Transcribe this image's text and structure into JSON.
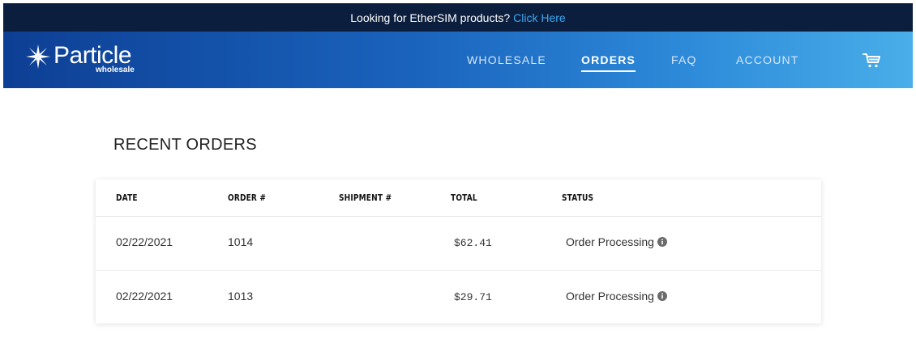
{
  "promo": {
    "text": "Looking for EtherSIM products?",
    "link": "Click Here",
    "link_color": "#3fa8f1"
  },
  "header": {
    "logo": {
      "brand": "Particle",
      "sub": "wholesale"
    },
    "nav": [
      {
        "label": "WHOLESALE",
        "active": false
      },
      {
        "label": "ORDERS",
        "active": true
      },
      {
        "label": "FAQ",
        "active": false
      },
      {
        "label": "ACCOUNT",
        "active": false
      }
    ],
    "cart_icon": "cart-icon"
  },
  "main": {
    "title": "RECENT ORDERS",
    "table": {
      "columns": [
        "DATE",
        "ORDER #",
        "SHIPMENT #",
        "TOTAL",
        "STATUS"
      ],
      "rows": [
        {
          "date": "02/22/2021",
          "order": "1014",
          "shipment": "",
          "total": "$62.41",
          "status": "Order Processing"
        },
        {
          "date": "02/22/2021",
          "order": "1013",
          "shipment": "",
          "total": "$29.71",
          "status": "Order Processing"
        }
      ],
      "status_icon": "info-icon"
    }
  },
  "colors": {
    "promo_bg": "#0c1e3e",
    "header_gradient_start": "#0d3f94",
    "header_gradient_end": "#49aee9"
  }
}
